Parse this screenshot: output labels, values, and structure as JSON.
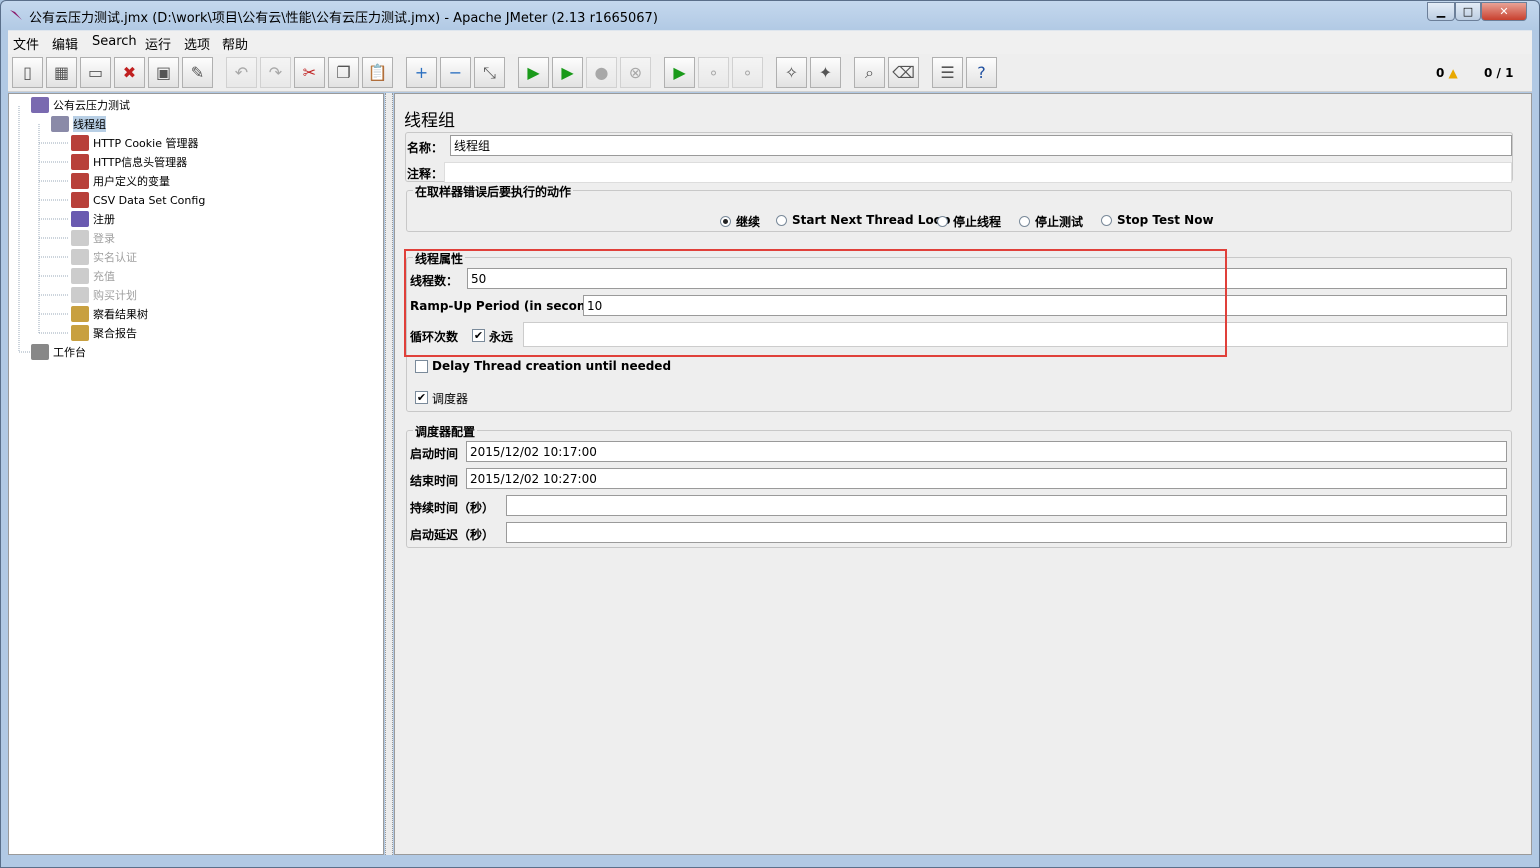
{
  "window": {
    "title": "公有云压力测试.jmx (D:\\work\\项目\\公有云\\性能\\公有云压力测试.jmx) - Apache JMeter (2.13 r1665067)"
  },
  "menu": [
    "文件",
    "编辑",
    "Search",
    "运行",
    "选项",
    "帮助"
  ],
  "toolbar": {
    "icons": [
      "new-icon",
      "templates-icon",
      "open-icon",
      "close-icon",
      "save-icon",
      "save-as-icon",
      "undo-icon",
      "redo-icon",
      "cut-icon",
      "copy-icon",
      "paste-icon",
      "expand-icon",
      "collapse-icon",
      "toggle-icon",
      "start-icon",
      "start-no-pause-icon",
      "stop-icon",
      "shutdown-icon",
      "remote-start-icon",
      "remote-stop-icon",
      "remote-shutdown-icon",
      "clear-icon",
      "clear-all-icon",
      "search-icon",
      "reset-search-icon",
      "function-helper-icon",
      "help-icon"
    ],
    "disabled": [
      6,
      7,
      16,
      17,
      19,
      20
    ]
  },
  "status": {
    "warnings": "0",
    "threads": "0 / 1"
  },
  "tree": [
    {
      "label": "公有云压力测试",
      "icon": "test-plan-icon",
      "level": 0,
      "disabled": false
    },
    {
      "label": "线程组",
      "icon": "thread-group-icon",
      "level": 1,
      "disabled": false,
      "selected": true
    },
    {
      "label": "HTTP Cookie 管理器",
      "icon": "config-element-icon",
      "level": 2,
      "disabled": false
    },
    {
      "label": "HTTP信息头管理器",
      "icon": "config-element-icon",
      "level": 2,
      "disabled": false
    },
    {
      "label": "用户定义的变量",
      "icon": "config-element-icon",
      "level": 2,
      "disabled": false
    },
    {
      "label": "CSV Data Set Config",
      "icon": "config-element-icon",
      "level": 2,
      "disabled": false
    },
    {
      "label": "注册",
      "icon": "sampler-icon",
      "level": 2,
      "disabled": false
    },
    {
      "label": "登录",
      "icon": "sampler-icon",
      "level": 2,
      "disabled": true
    },
    {
      "label": "实名认证",
      "icon": "sampler-icon",
      "level": 2,
      "disabled": true
    },
    {
      "label": "充值",
      "icon": "sampler-icon",
      "level": 2,
      "disabled": true
    },
    {
      "label": "购买计划",
      "icon": "sampler-icon",
      "level": 2,
      "disabled": true
    },
    {
      "label": "察看结果树",
      "icon": "listener-icon",
      "level": 2,
      "disabled": false
    },
    {
      "label": "聚合报告",
      "icon": "listener-icon",
      "level": 2,
      "disabled": false
    },
    {
      "label": "工作台",
      "icon": "workbench-icon",
      "level": 0,
      "disabled": false
    }
  ],
  "panel": {
    "heading": "线程组",
    "name_label": "名称：",
    "name_value": "线程组",
    "comment_label": "注释：",
    "comment_value": "",
    "error_group": "在取样器错误后要执行的动作",
    "error_options": [
      {
        "label": "继续",
        "selected": true
      },
      {
        "label": "Start Next Thread Loop",
        "selected": false
      },
      {
        "label": "停止线程",
        "selected": false
      },
      {
        "label": "停止测试",
        "selected": false
      },
      {
        "label": "Stop Test Now",
        "selected": false
      }
    ],
    "thread_group": "线程属性",
    "threads_label": "线程数：",
    "threads_value": "50",
    "rampup_label": "Ramp-Up Period (in seconds):",
    "rampup_value": "10",
    "loop_label": "循环次数",
    "forever_label": "永远",
    "forever_checked": true,
    "loop_value": "",
    "delay_label": "Delay Thread creation until needed",
    "delay_checked": false,
    "scheduler_label": "调度器",
    "scheduler_checked": true,
    "sched_group": "调度器配置",
    "start_label": "启动时间",
    "start_value": "2015/12/02 10:17:00",
    "end_label": "结束时间",
    "end_value": "2015/12/02 10:27:00",
    "duration_label": "持续时间（秒）",
    "duration_value": "",
    "delay_start_label": "启动延迟（秒）",
    "delay_start_value": "",
    "highlight_color": "#e0403a"
  }
}
